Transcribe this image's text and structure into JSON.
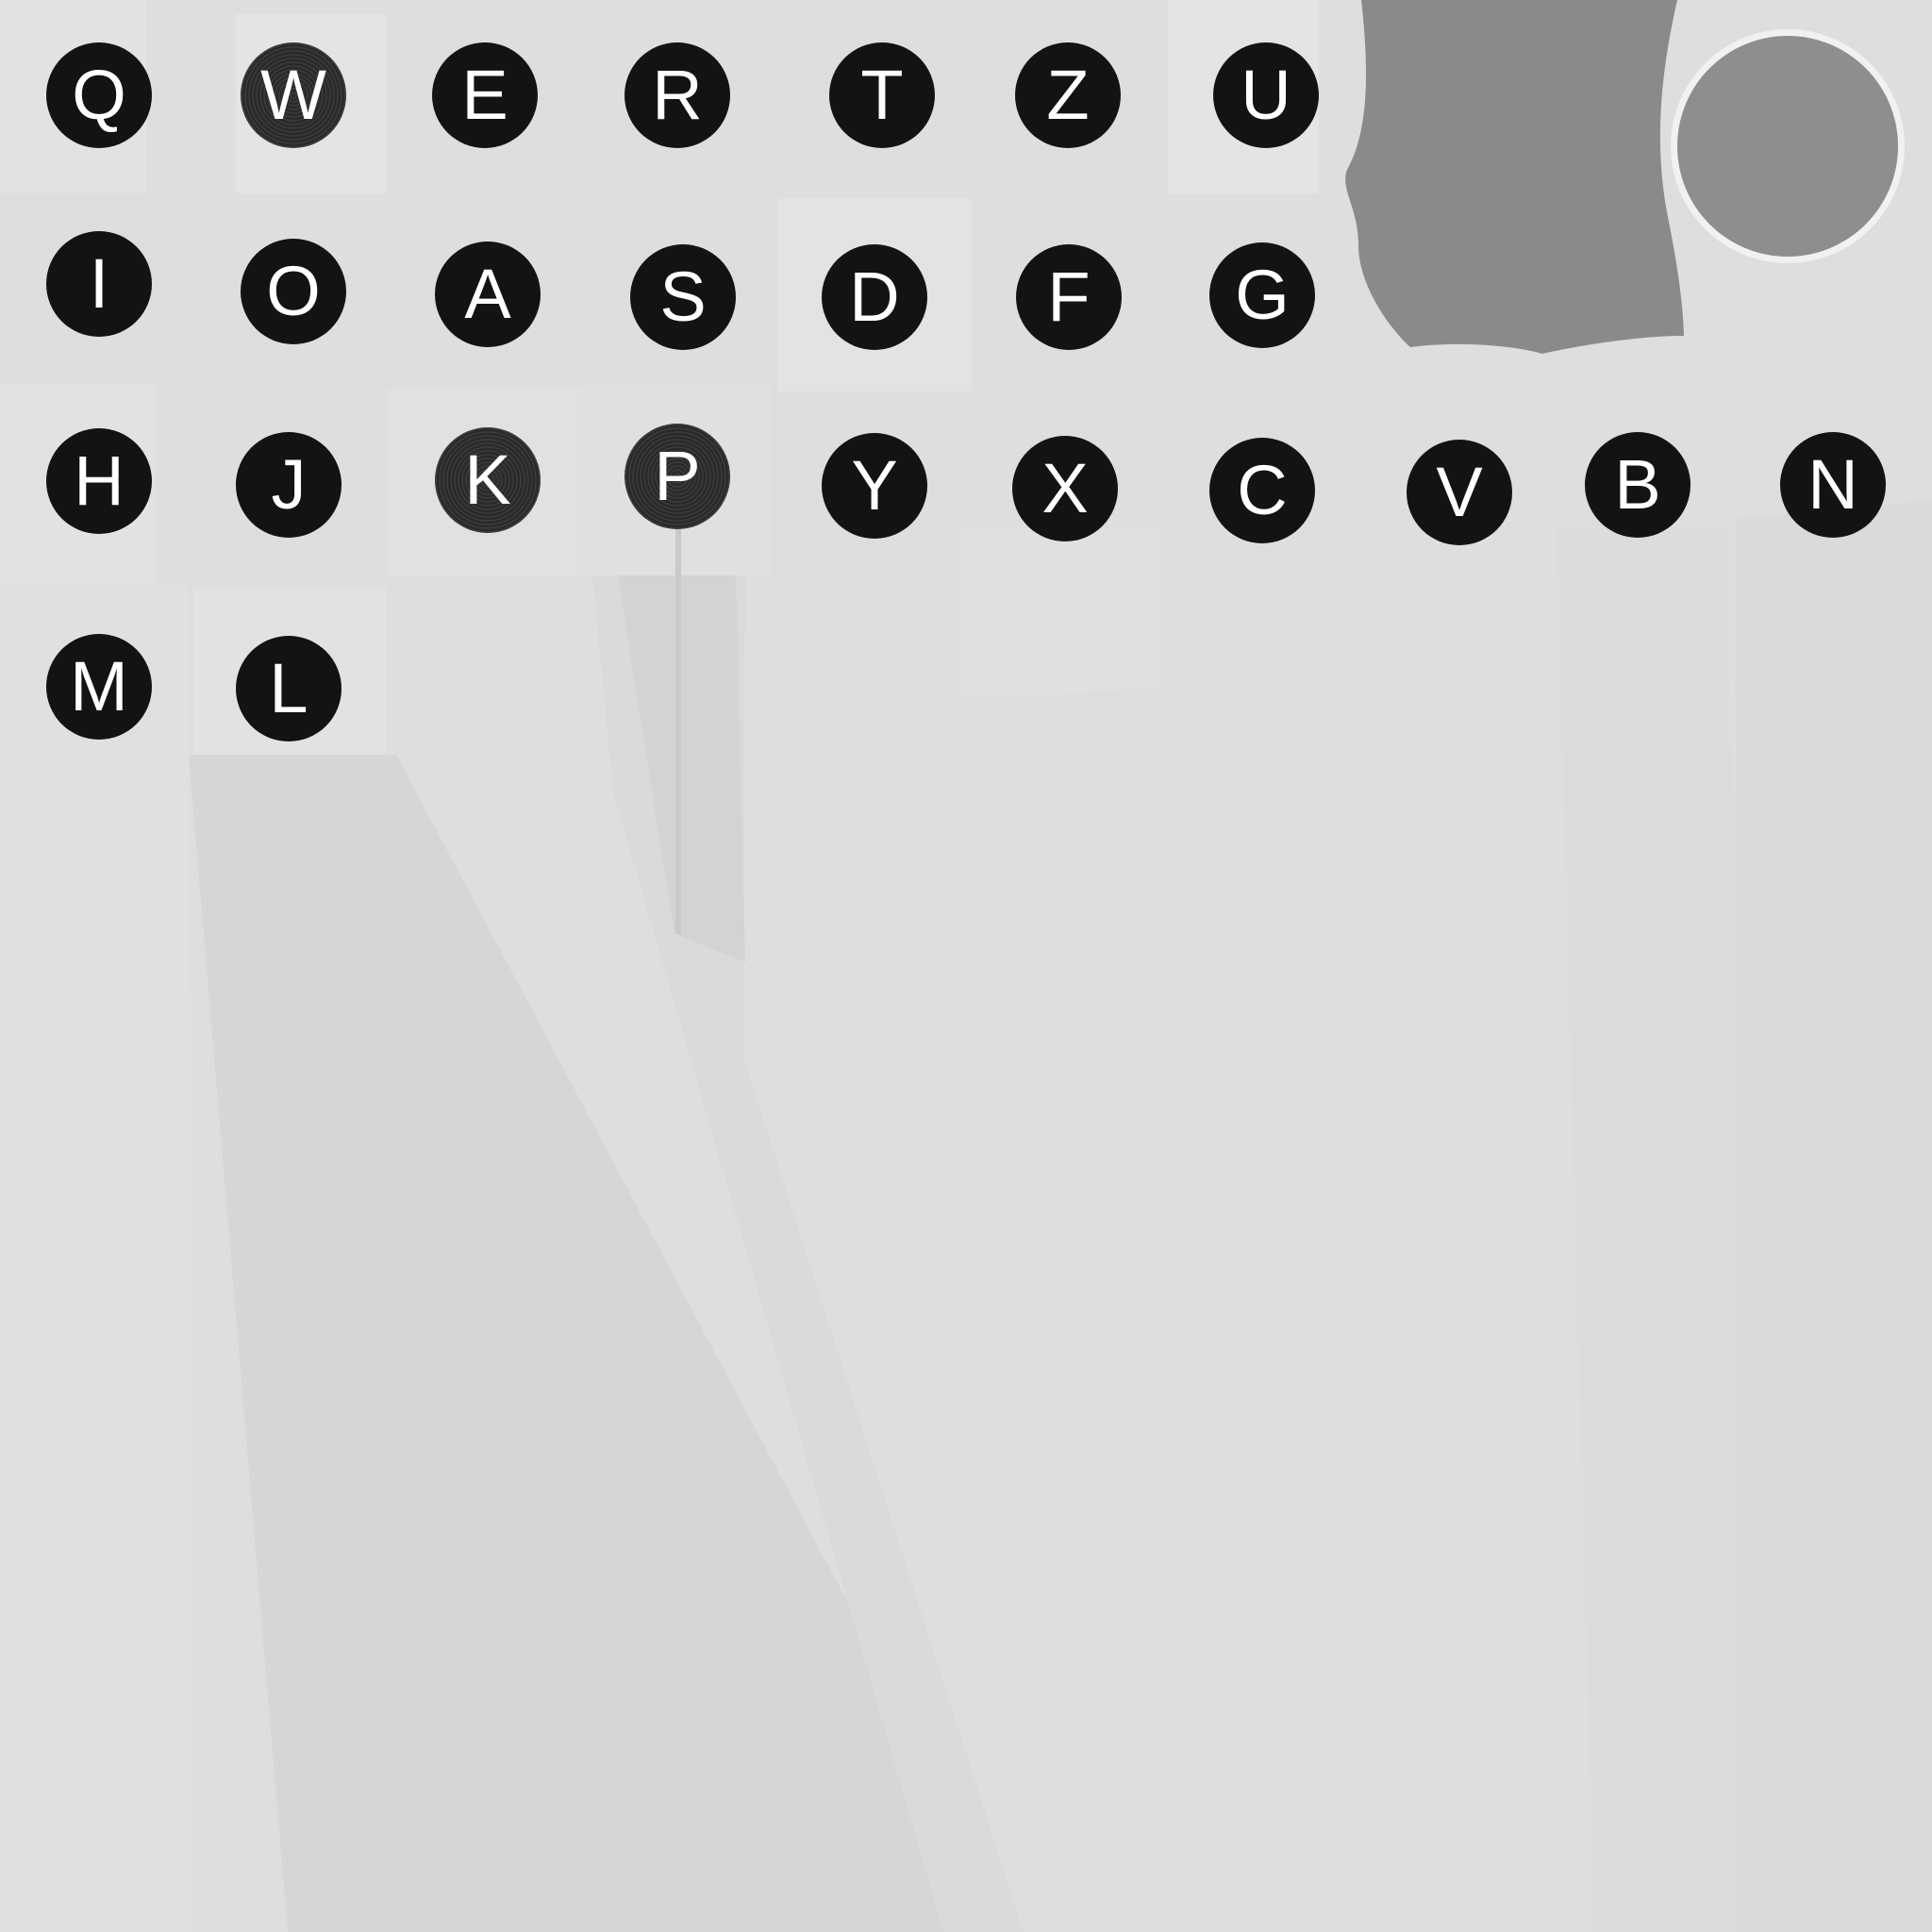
{
  "atlas": {
    "colors": {
      "background": "#dedede",
      "panel_light": "#e3e3e3",
      "panel_mid": "#d6d6d6",
      "key_fill": "#131313",
      "key_text": "#ffffff",
      "shape_gray": "#8a8a8c",
      "circle_gray": "#8e8e90",
      "circle_ring": "#f2f2f2"
    },
    "rows": [
      {
        "keys": [
          {
            "label": "Q"
          },
          {
            "label": "W",
            "textured": true
          },
          {
            "label": "E"
          },
          {
            "label": "R"
          },
          {
            "label": "T"
          },
          {
            "label": "Z"
          },
          {
            "label": "U"
          }
        ]
      },
      {
        "keys": [
          {
            "label": "I"
          },
          {
            "label": "O"
          },
          {
            "label": "A"
          },
          {
            "label": "S"
          },
          {
            "label": "D"
          },
          {
            "label": "F"
          },
          {
            "label": "G"
          }
        ]
      },
      {
        "keys": [
          {
            "label": "H"
          },
          {
            "label": "J"
          },
          {
            "label": "K",
            "textured": true
          },
          {
            "label": "P",
            "textured": true
          },
          {
            "label": "Y"
          },
          {
            "label": "X"
          },
          {
            "label": "C"
          },
          {
            "label": "V"
          },
          {
            "label": "B"
          },
          {
            "label": "N"
          }
        ]
      },
      {
        "keys": [
          {
            "label": "M"
          },
          {
            "label": "L"
          }
        ]
      }
    ]
  }
}
